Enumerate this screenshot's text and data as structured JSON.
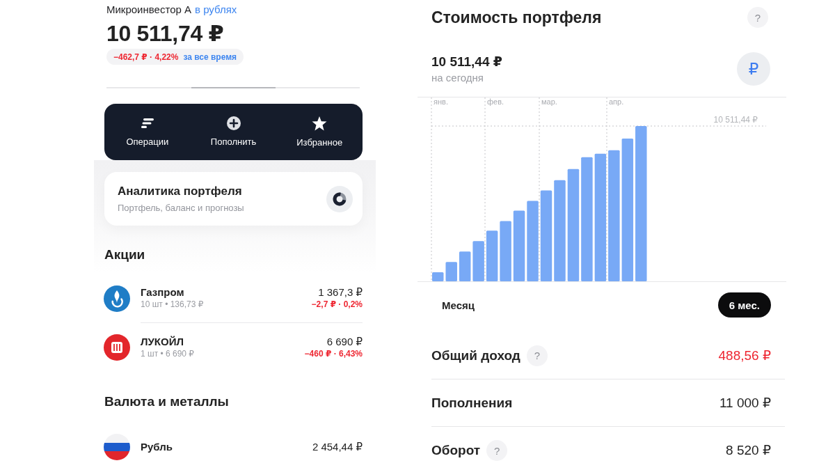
{
  "account": {
    "name": "Микроинвестор А",
    "currency_link": "в рублях",
    "total": "10 511,74 ₽",
    "change": {
      "text": "−462,7 ₽ · 4,22%",
      "negative": true,
      "period": "за все время"
    }
  },
  "actions": [
    {
      "kind": "lines",
      "label": "Операции"
    },
    {
      "kind": "plus",
      "label": "Пополнить"
    },
    {
      "kind": "star",
      "label": "Избранное"
    }
  ],
  "analytics_card": {
    "title": "Аналитика портфеля",
    "subtitle": "Портфель, баланс и прогнозы"
  },
  "stocks": {
    "title": "Акции",
    "items": [
      {
        "kind": "flame",
        "color": "#1f7dc6",
        "name": "Газпром",
        "details": "10 шт • 136,73 ₽",
        "value": "1 367,3 ₽",
        "change": "−2,7 ₽ · 0,2%",
        "negative": true
      },
      {
        "kind": "emblem",
        "color": "#e3262b",
        "name": "ЛУКОЙЛ",
        "details": "1 шт • 6 690 ₽",
        "value": "6 690 ₽",
        "change": "−460 ₽ · 6,43%",
        "negative": true
      }
    ]
  },
  "currencies": {
    "title": "Валюта и металлы",
    "items": [
      {
        "kind": "flag",
        "name": "Рубль",
        "value": "2 454,44 ₽"
      }
    ]
  },
  "portfolio_value": {
    "title": "Стоимость портфеля",
    "help": "?",
    "value": "10 511,44 ₽",
    "caption": "на сегодня",
    "currency_button": "₽",
    "chart": {
      "month_labels": [
        "янв.",
        "фев.",
        "мар.",
        "апр."
      ],
      "max_label": "10 511,44 ₽"
    },
    "periods": [
      {
        "label": "Месяц",
        "selected": false
      },
      {
        "label": "6 мес.",
        "selected": true
      }
    ],
    "stats": [
      {
        "label": "Общий доход",
        "hint": "?",
        "value": "488,56 ₽",
        "negative": true
      },
      {
        "label": "Пополнения",
        "value": "11 000 ₽",
        "negative": false
      },
      {
        "label": "Оборот",
        "hint": "?",
        "value": "8 520 ₽",
        "negative": false
      }
    ]
  }
}
